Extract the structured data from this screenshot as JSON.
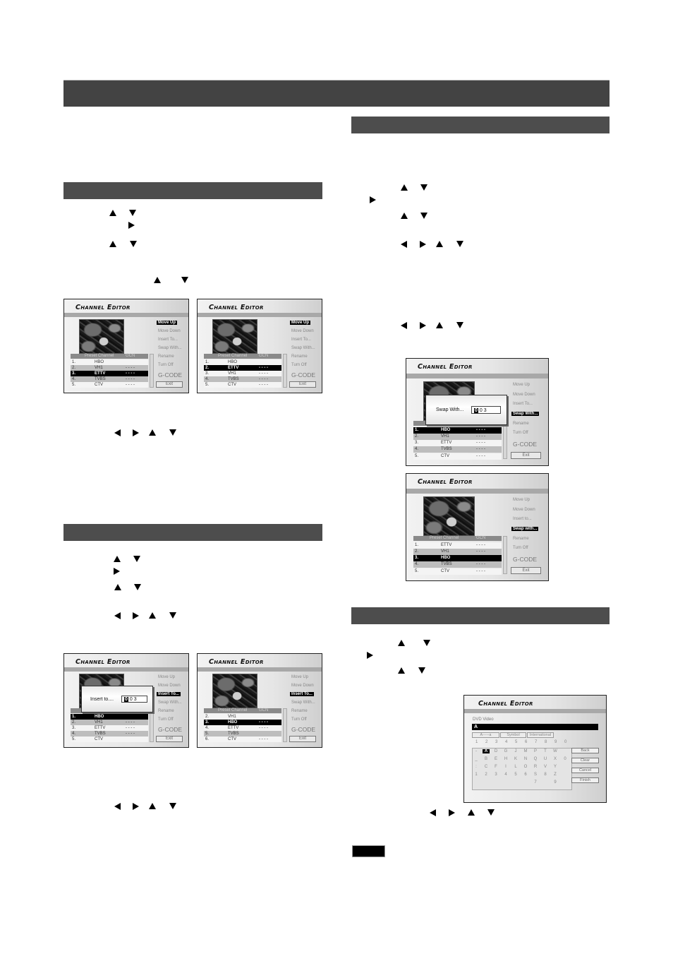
{
  "page": {
    "sections": [
      {
        "id": "main-header",
        "title": ""
      },
      {
        "id": "move-up-down",
        "title": ""
      },
      {
        "id": "insert-to",
        "title": ""
      },
      {
        "id": "swap-with",
        "title": ""
      },
      {
        "id": "rename",
        "title": ""
      }
    ],
    "note_label": ""
  },
  "icons": {
    "up": "arrow-up-icon",
    "down": "arrow-down-icon",
    "left": "arrow-left-icon",
    "right": "arrow-right-icon"
  },
  "editor": {
    "title": "Channel Editor",
    "table_headers": {
      "channel": "Preset Channel",
      "gcn": "GCN"
    },
    "menu": {
      "move_up": "Move Up",
      "move_down": "Move Down",
      "insert_to": "Insert To...",
      "insert_to_alt": "Insert to...",
      "swap_with": "Swap With...",
      "swap_with_alt": "Swap with...",
      "rename": "Rename",
      "turn_off": "Turn Off",
      "gcode": "G-CODE",
      "exit": "Exit"
    },
    "gcn_blank": "- - - -"
  },
  "screens": {
    "move1": {
      "selected_menu": "Move Up",
      "rows": [
        {
          "num": "1.",
          "name": "HBO",
          "gcn": "",
          "style": "light"
        },
        {
          "num": "2.",
          "name": "VH1",
          "gcn": "- - - -",
          "style": "mid"
        },
        {
          "num": "3.",
          "name": "ETTV",
          "gcn": "- - - -",
          "style": "dark"
        },
        {
          "num": "4.",
          "name": "TVBS",
          "gcn": "- - - -",
          "style": "mid"
        },
        {
          "num": "5.",
          "name": "CTV",
          "gcn": "- - - -",
          "style": "light"
        }
      ]
    },
    "move2": {
      "selected_menu": "Move Up",
      "rows": [
        {
          "num": "1.",
          "name": "HBO",
          "gcn": "",
          "style": "light"
        },
        {
          "num": "2.",
          "name": "ETTV",
          "gcn": "- - - -",
          "style": "dark"
        },
        {
          "num": "3.",
          "name": "VH1",
          "gcn": "- - - -",
          "style": "light"
        },
        {
          "num": "4.",
          "name": "TVBS",
          "gcn": "- - - -",
          "style": "mid"
        },
        {
          "num": "5.",
          "name": "CTV",
          "gcn": "- - - -",
          "style": "light"
        }
      ]
    },
    "insert1": {
      "selected_menu": "Insert To...",
      "dialog_label": "Insert to....",
      "dialog_value_cursor": "0",
      "dialog_value_rest": "0 3",
      "rows": [
        {
          "num": "1.",
          "name": "HBO",
          "gcn": "",
          "style": "dark"
        },
        {
          "num": "2.",
          "name": "VH1",
          "gcn": "- - - -",
          "style": "mid"
        },
        {
          "num": "3.",
          "name": "ETTV",
          "gcn": "- - - -",
          "style": "light"
        },
        {
          "num": "4.",
          "name": "TVBS",
          "gcn": "- - - -",
          "style": "mid"
        },
        {
          "num": "5.",
          "name": "CTV",
          "gcn": "",
          "style": "light"
        }
      ]
    },
    "insert2": {
      "selected_menu": "Insert To...",
      "rows": [
        {
          "num": "2.",
          "name": "VH1",
          "gcn": "",
          "style": "light"
        },
        {
          "num": "3.",
          "name": "HBO",
          "gcn": "- - - -",
          "style": "dark"
        },
        {
          "num": "4.",
          "name": "ETTV",
          "gcn": "- - - -",
          "style": "light"
        },
        {
          "num": "5.",
          "name": "TVBS",
          "gcn": "",
          "style": "mid"
        },
        {
          "num": "6.",
          "name": "CTV",
          "gcn": "- - - -",
          "style": "light"
        }
      ]
    },
    "swap1": {
      "selected_menu": "Swap With...",
      "dialog_label": "Swap With...",
      "dialog_value_cursor": "0",
      "dialog_value_rest": "0 3",
      "rows": [
        {
          "num": "1.",
          "name": "HBO",
          "gcn": "- - - -",
          "style": "dark"
        },
        {
          "num": "2.",
          "name": "VH1",
          "gcn": "- - - -",
          "style": "mid"
        },
        {
          "num": "3.",
          "name": "ETTV",
          "gcn": "- - - -",
          "style": "light"
        },
        {
          "num": "4.",
          "name": "TVBS",
          "gcn": "- - - -",
          "style": "mid"
        },
        {
          "num": "5.",
          "name": "CTV",
          "gcn": "- - - -",
          "style": "light"
        }
      ]
    },
    "swap2": {
      "selected_menu": "Swap with...",
      "rows": [
        {
          "num": "1.",
          "name": "ETTV",
          "gcn": "- - - -",
          "style": "light"
        },
        {
          "num": "2.",
          "name": "VH1",
          "gcn": "- - - -",
          "style": "mid"
        },
        {
          "num": "3.",
          "name": "HBO",
          "gcn": "",
          "style": "dark"
        },
        {
          "num": "4.",
          "name": "TVBS",
          "gcn": "- - - -",
          "style": "mid"
        },
        {
          "num": "5.",
          "name": "CTV",
          "gcn": "- - - -",
          "style": "light"
        }
      ]
    },
    "rename": {
      "name_label": "DVD Video",
      "field_value": "A",
      "tabs": [
        "A-----a",
        "Symbol",
        "International"
      ],
      "digits": [
        "1",
        "2",
        "3",
        "4",
        "5",
        "6",
        "7",
        "8",
        "9",
        "0"
      ],
      "key_rows": [
        [
          "-",
          "A",
          "D",
          "G",
          "J",
          "M",
          "P",
          "T",
          "W",
          ""
        ],
        [
          "_",
          "B",
          "E",
          "H",
          "K",
          "N",
          "Q",
          "U",
          "X",
          "0"
        ],
        [
          ":",
          "C",
          "F",
          "I",
          "L",
          "O",
          "R",
          "V",
          "Y",
          ""
        ],
        [
          "1",
          "2",
          "3",
          "4",
          "5",
          "6",
          "S",
          "8",
          "Z",
          ""
        ],
        [
          "",
          "",
          "",
          "",
          "",
          "",
          "7",
          "",
          "9",
          ""
        ]
      ],
      "selected_key": "A",
      "buttons": [
        "Back",
        "Clear",
        "Cancel",
        "Finish"
      ]
    }
  }
}
